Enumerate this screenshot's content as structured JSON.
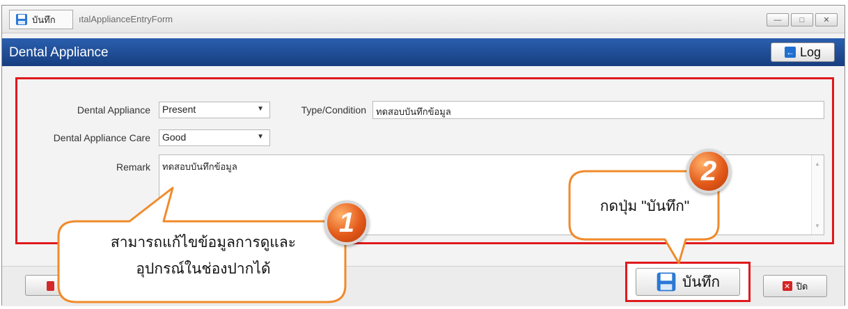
{
  "window": {
    "title": "ıtalApplianceEntryForm",
    "save_tab_label": "บันทึก",
    "controls": [
      "—",
      "□",
      "✕"
    ]
  },
  "header": {
    "title": "Dental Appliance",
    "log_label": "Log"
  },
  "form": {
    "appliance_label": "Dental Appliance",
    "appliance_value": "Present",
    "type_label": "Type/Condition",
    "type_value": "ทดสอบบันทึกข้อมูล",
    "care_label": "Dental Appliance Care",
    "care_value": "Good",
    "remark_label": "Remark",
    "remark_value": "ทดสอบบันทึกข้อมูล"
  },
  "footer": {
    "save_label": "บันทึก",
    "close_label": "ปิด"
  },
  "callouts": {
    "one_line1": "สามารถแก้ไขข้อมูลการดูและ",
    "one_line2": "อุปกรณ์ในช่องปากได้",
    "one_badge": "1",
    "two_text": "กดปุ่ม \"บันทึก\"",
    "two_badge": "2"
  },
  "colors": {
    "header": "#1f4b95",
    "highlight": "#e0191d",
    "callout_border": "#f08a2a"
  }
}
